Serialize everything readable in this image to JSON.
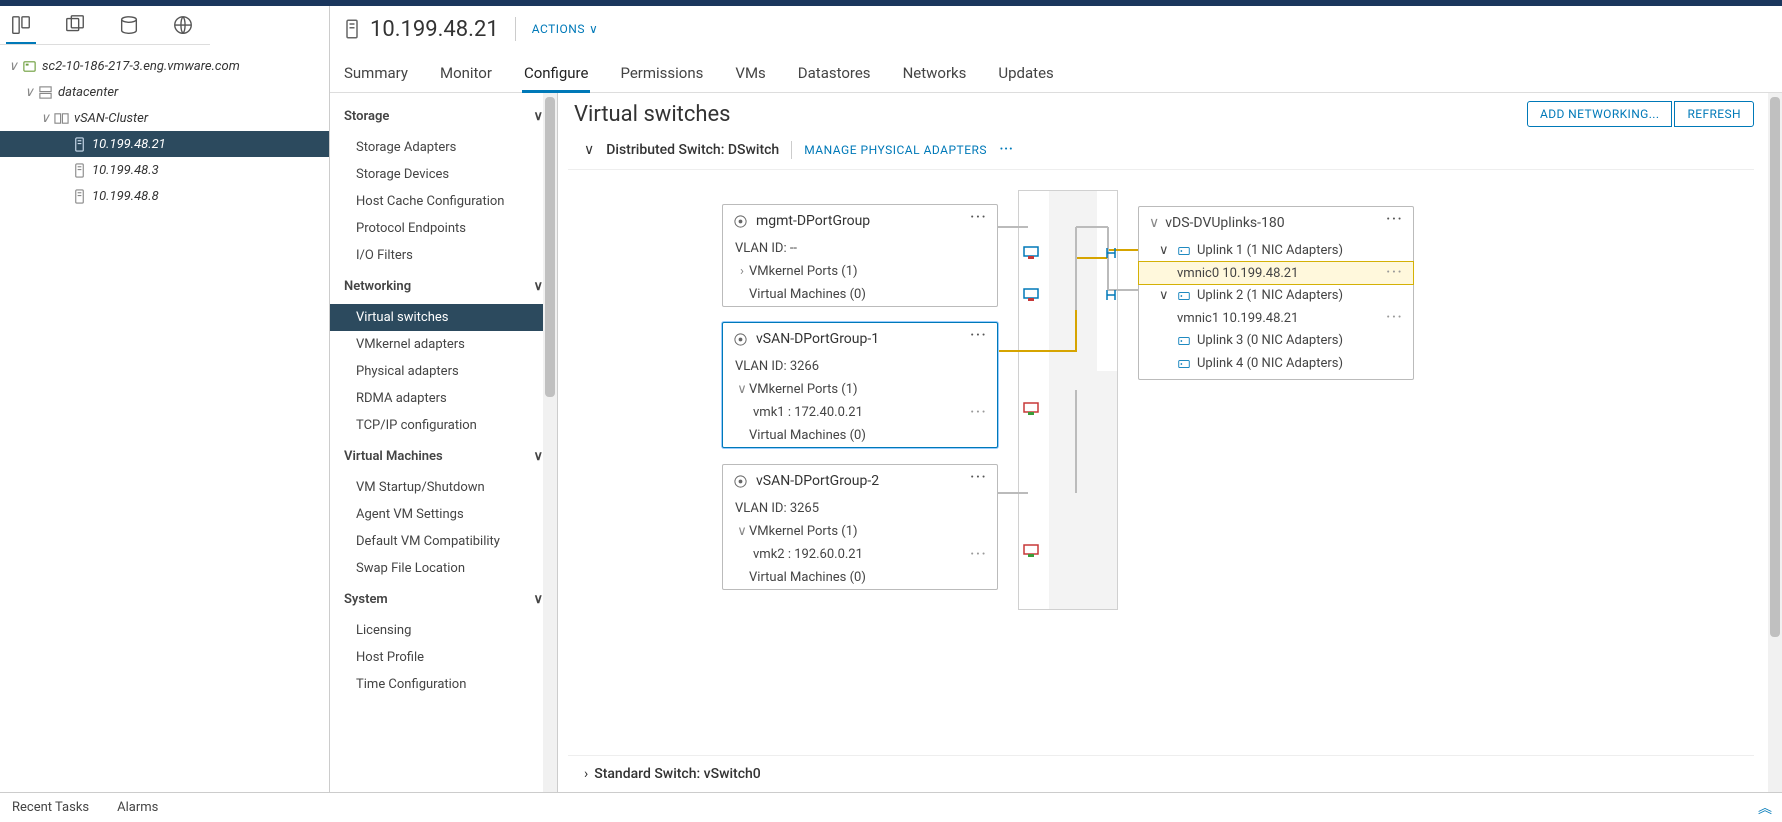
{
  "tree": {
    "root": "sc2-10-186-217-3.eng.vmware.com",
    "datacenter": "datacenter",
    "cluster": "vSAN-Cluster",
    "hosts": [
      "10.199.48.21",
      "10.199.48.3",
      "10.199.48.8"
    ]
  },
  "header": {
    "title": "10.199.48.21",
    "actions": "ACTIONS"
  },
  "tabs": [
    "Summary",
    "Monitor",
    "Configure",
    "Permissions",
    "VMs",
    "Datastores",
    "Networks",
    "Updates"
  ],
  "config_nav": {
    "sections": [
      {
        "title": "Storage",
        "items": [
          "Storage Adapters",
          "Storage Devices",
          "Host Cache Configuration",
          "Protocol Endpoints",
          "I/O Filters"
        ]
      },
      {
        "title": "Networking",
        "items": [
          "Virtual switches",
          "VMkernel adapters",
          "Physical adapters",
          "RDMA adapters",
          "TCP/IP configuration"
        ]
      },
      {
        "title": "Virtual Machines",
        "items": [
          "VM Startup/Shutdown",
          "Agent VM Settings",
          "Default VM Compatibility",
          "Swap File Location"
        ]
      },
      {
        "title": "System",
        "items": [
          "Licensing",
          "Host Profile",
          "Time Configuration"
        ]
      }
    ],
    "selected": "Virtual switches"
  },
  "body": {
    "title": "Virtual switches",
    "btn_add": "ADD NETWORKING...",
    "btn_refresh": "REFRESH",
    "dswitch_label": "Distributed Switch: DSwitch",
    "manage_link": "MANAGE PHYSICAL ADAPTERS",
    "std_switch_label": "Standard Switch: vSwitch0"
  },
  "port_groups": [
    {
      "name": "mgmt-DPortGroup",
      "vlan": "VLAN ID: --",
      "vmk_head": "VMkernel Ports (1)",
      "vms": "Virtual Machines (0)",
      "expanded": false
    },
    {
      "name": "vSAN-DPortGroup-1",
      "vlan": "VLAN ID: 3266",
      "vmk_head": "VMkernel Ports (1)",
      "vmk_item": "vmk1 : 172.40.0.21",
      "vms": "Virtual Machines (0)",
      "expanded": true,
      "selected": true
    },
    {
      "name": "vSAN-DPortGroup-2",
      "vlan": "VLAN ID: 3265",
      "vmk_head": "VMkernel Ports (1)",
      "vmk_item": "vmk2 : 192.60.0.21",
      "vms": "Virtual Machines (0)",
      "expanded": true
    }
  ],
  "uplinks": {
    "title": "vDS-DVUplinks-180",
    "items": [
      {
        "label": "Uplink 1 (1 NIC Adapters)",
        "expanded": true,
        "nic": "vmnic0 10.199.48.21",
        "nic_selected": true
      },
      {
        "label": "Uplink 2 (1 NIC Adapters)",
        "expanded": true,
        "nic": "vmnic1 10.199.48.21"
      },
      {
        "label": "Uplink 3 (0 NIC Adapters)",
        "expanded": false
      },
      {
        "label": "Uplink 4 (0 NIC Adapters)",
        "expanded": false
      }
    ]
  },
  "bottom": {
    "recent": "Recent Tasks",
    "alarms": "Alarms"
  }
}
